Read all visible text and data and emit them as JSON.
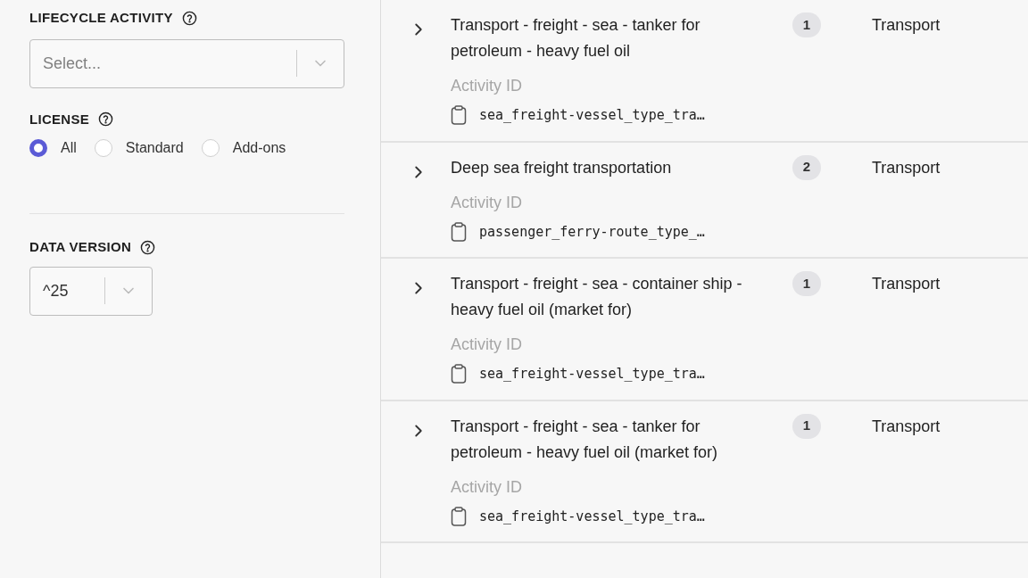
{
  "filters": {
    "lifecycle_activity": {
      "label": "LIFECYCLE ACTIVITY",
      "placeholder": "Select..."
    },
    "license": {
      "label": "LICENSE",
      "options": [
        {
          "label": "All",
          "selected": true
        },
        {
          "label": "Standard",
          "selected": false
        },
        {
          "label": "Add-ons",
          "selected": false
        }
      ]
    },
    "data_version": {
      "label": "DATA VERSION",
      "value": "^25"
    }
  },
  "results": [
    {
      "title": "Transport - freight - sea - tanker for petroleum - heavy fuel oil",
      "count": "1",
      "category": "Transport",
      "id_label": "Activity ID",
      "activity_id": "sea_freight-vessel_type_tra…"
    },
    {
      "title": "Deep sea freight transportation",
      "count": "2",
      "category": "Transport",
      "id_label": "Activity ID",
      "activity_id": "passenger_ferry-route_type_…"
    },
    {
      "title": "Transport - freight - sea - container ship - heavy fuel oil (market for)",
      "count": "1",
      "category": "Transport",
      "id_label": "Activity ID",
      "activity_id": "sea_freight-vessel_type_tra…"
    },
    {
      "title": "Transport - freight - sea - tanker for petroleum - heavy fuel oil (market for)",
      "count": "1",
      "category": "Transport",
      "id_label": "Activity ID",
      "activity_id": "sea_freight-vessel_type_tra…"
    }
  ]
}
